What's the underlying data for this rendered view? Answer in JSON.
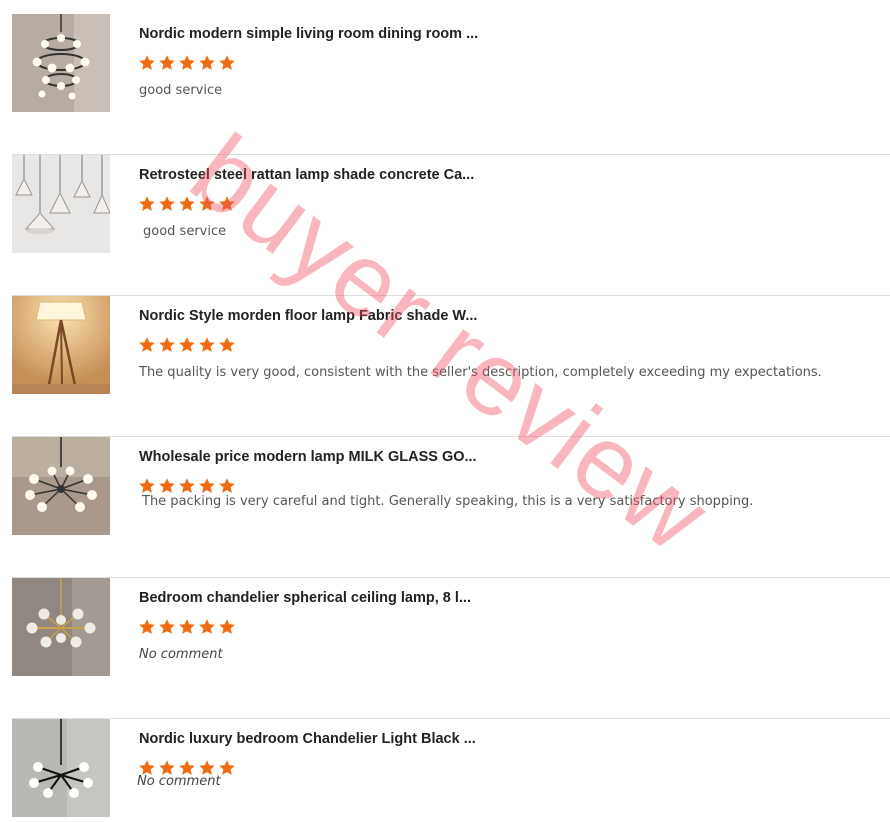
{
  "reviews": [
    {
      "title": "Nordic modern simple living room dining room ...",
      "rating": 5,
      "comment": "good service",
      "comment_style": "normal",
      "image": "chandelier-rings-photo"
    },
    {
      "title": "Retrosteel steel rattan lamp shade concrete Ca...",
      "rating": 5,
      "comment": "good service",
      "comment_style": "normal",
      "image": "pendant-lamps-photo"
    },
    {
      "title": "Nordic Style morden floor lamp Fabric shade W...",
      "rating": 5,
      "comment": "The quality is very good, consistent with the seller's description, completely exceeding my expectations.",
      "comment_style": "normal",
      "image": "floor-lamp-photo"
    },
    {
      "title": "Wholesale price modern lamp MILK GLASS GO...",
      "rating": 5,
      "comment": "The packing is very careful and tight. Generally speaking, this is a very satisfactory shopping.",
      "comment_style": "normal",
      "image": "milk-glass-chandelier-photo"
    },
    {
      "title": "Bedroom chandelier spherical ceiling lamp, 8 l...",
      "rating": 5,
      "comment": "No comment",
      "comment_style": "italic",
      "image": "gold-chandelier-photo"
    },
    {
      "title": "Nordic luxury bedroom Chandelier Light Black ...",
      "rating": 5,
      "comment": "No comment",
      "comment_style": "italic",
      "image": "black-chandelier-photo"
    }
  ],
  "watermark": "buyer review",
  "colors": {
    "star": "#f06a0f",
    "divider": "#dedede",
    "watermark": "#f05064"
  }
}
